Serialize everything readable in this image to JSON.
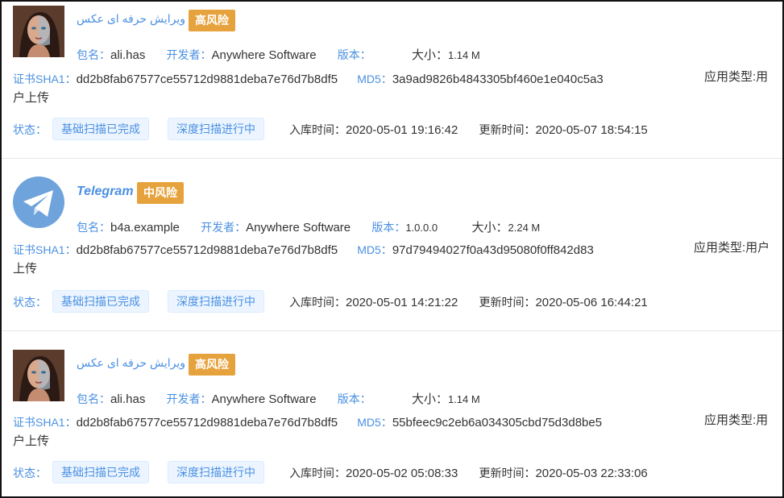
{
  "labels": {
    "package": "包名：",
    "developer": "开发者：",
    "version": "版本：",
    "size": "大小：",
    "sha1": "证书SHA1：",
    "md5": "MD5：",
    "app_type": "应用类型:",
    "status": "状态：",
    "import_time": "入库时间：",
    "update_time": "更新时间："
  },
  "status_tags": {
    "basic_scan": "基础扫描已完成",
    "deep_scan": "深度扫描进行中"
  },
  "colors": {
    "link_blue": "#4a90e2",
    "risk_orange": "#e6a23c",
    "tag_bg": "#ecf5ff"
  },
  "apps": [
    {
      "icon": "portrait-photo-icon",
      "name": "ویرایش حرفه ای عکس",
      "risk": "高风险",
      "package": "ali.has",
      "developer": "Anywhere Software",
      "version": "",
      "size": "1.14 M",
      "sha1": "dd2b8fab67577ce55712d9881deba7e76d7b8df5",
      "md5": "3a9ad9826b4843305bf460e1e040c5a3",
      "app_type_line1": "用",
      "app_type_line2": "户上传",
      "import_time": "2020-05-01 19:16:42",
      "update_time": "2020-05-07 18:54:15"
    },
    {
      "icon": "telegram-icon",
      "name": "Telegram",
      "risk": "中风险",
      "package": "b4a.example",
      "developer": "Anywhere Software",
      "version": "1.0.0.0",
      "size": "2.24 M",
      "sha1": "dd2b8fab67577ce55712d9881deba7e76d7b8df5",
      "md5": "97d79494027f0a43d95080f0ff842d83",
      "app_type_line1": "用户",
      "app_type_line2": "上传",
      "import_time": "2020-05-01 14:21:22",
      "update_time": "2020-05-06 16:44:21"
    },
    {
      "icon": "portrait-photo-icon",
      "name": "ویرایش حرفه ای عکس",
      "risk": "高风险",
      "package": "ali.has",
      "developer": "Anywhere Software",
      "version": "",
      "size": "1.14 M",
      "sha1": "dd2b8fab67577ce55712d9881deba7e76d7b8df5",
      "md5": "55bfeec9c2eb6a034305cbd75d3d8be5",
      "app_type_line1": "用",
      "app_type_line2": "户上传",
      "import_time": "2020-05-02 05:08:33",
      "update_time": "2020-05-03 22:33:06"
    }
  ]
}
